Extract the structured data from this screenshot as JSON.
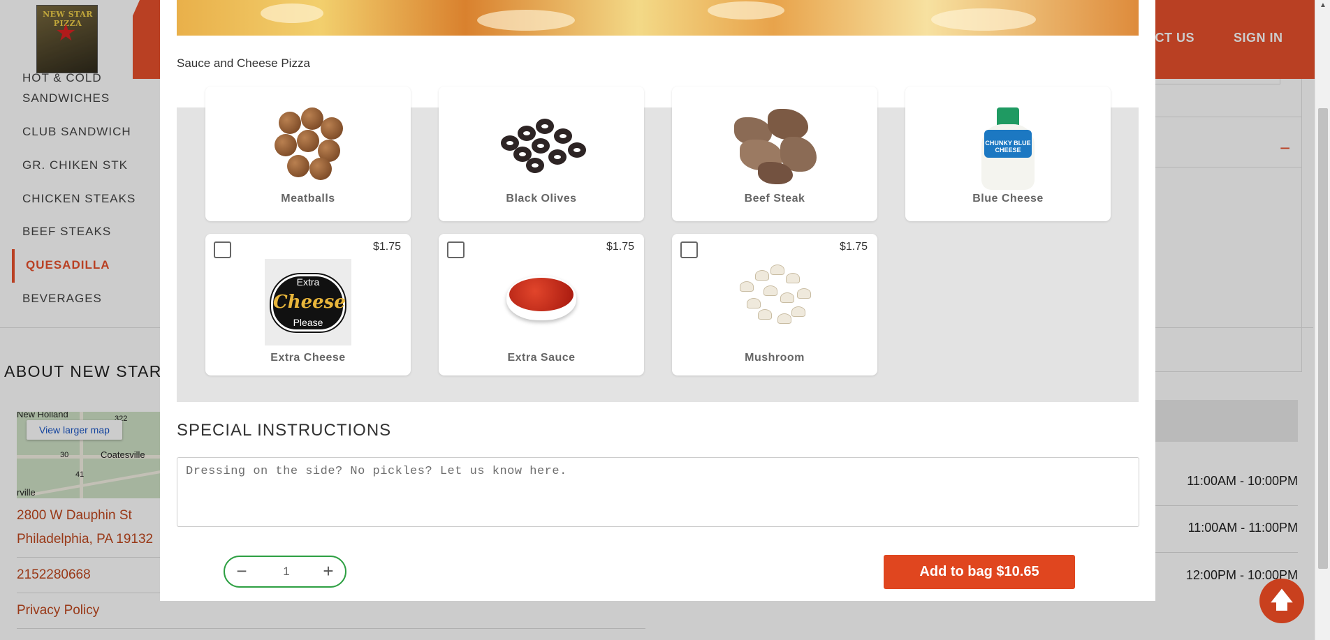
{
  "header": {
    "logo_text": "NEW STAR PIZZA",
    "nav": [
      "ACT US",
      "SIGN IN"
    ]
  },
  "sidebar": {
    "items": [
      {
        "label": "HOT & COLD"
      },
      {
        "label": "SANDWICHES"
      },
      {
        "label": "CLUB SANDWICH"
      },
      {
        "label": "Gr. CHIKEN STK"
      },
      {
        "label": "CHICKEN STEAKS"
      },
      {
        "label": "BEEF STEAKS"
      },
      {
        "label": "QUESADILLA",
        "active": true
      },
      {
        "label": "BEVERAGES"
      }
    ]
  },
  "about": {
    "title": "ABOUT NEW STAR P",
    "map": {
      "button_label": "View larger map",
      "labels": [
        "New Holland",
        "Coatesville",
        "30",
        "41",
        "322",
        "rville"
      ]
    },
    "address_line1": "2800 W Dauphin St",
    "address_line2": "Philadelphia, PA 19132",
    "phone": "2152280668",
    "privacy_link": "Privacy Policy"
  },
  "hours": [
    {
      "time": "11:00AM - 10:00PM"
    },
    {
      "time": "11:00AM - 11:00PM"
    },
    {
      "time": "12:00PM - 10:00PM"
    }
  ],
  "right_panel": {
    "toggle_icon": "minus-icon"
  },
  "modal": {
    "item_description": "Sauce and Cheese Pizza",
    "options_row1": [
      {
        "name": "Meatballs",
        "icon": "meatballs-image"
      },
      {
        "name": "Black Olives",
        "icon": "black-olives-image"
      },
      {
        "name": "Beef Steak",
        "icon": "beef-steak-image"
      },
      {
        "name": "Blue Cheese",
        "icon": "blue-cheese-dressing-image",
        "bottle_label": "CHUNKY BLUE CHEESE"
      }
    ],
    "options_row2": [
      {
        "name": "Extra Cheese",
        "price": "$1.75",
        "icon": "extra-cheese-image",
        "image_text": {
          "top": "Extra",
          "main": "Cheese",
          "bottom": "Please"
        }
      },
      {
        "name": "Extra Sauce",
        "price": "$1.75",
        "icon": "extra-sauce-image"
      },
      {
        "name": "Mushroom",
        "price": "$1.75",
        "icon": "mushroom-image"
      }
    ],
    "special_instructions": {
      "title": "SPECIAL INSTRUCTIONS",
      "placeholder": "Dressing on the side? No pickles? Let us know here.",
      "value": ""
    },
    "quantity": {
      "value": "1",
      "minus": "−",
      "plus": "+"
    },
    "add_to_bag_label": "Add to bag $10.65"
  },
  "colors": {
    "brand": "#e8512c",
    "button": "#e0461f",
    "quantity_border": "#2ea043",
    "link": "#c0481f"
  }
}
